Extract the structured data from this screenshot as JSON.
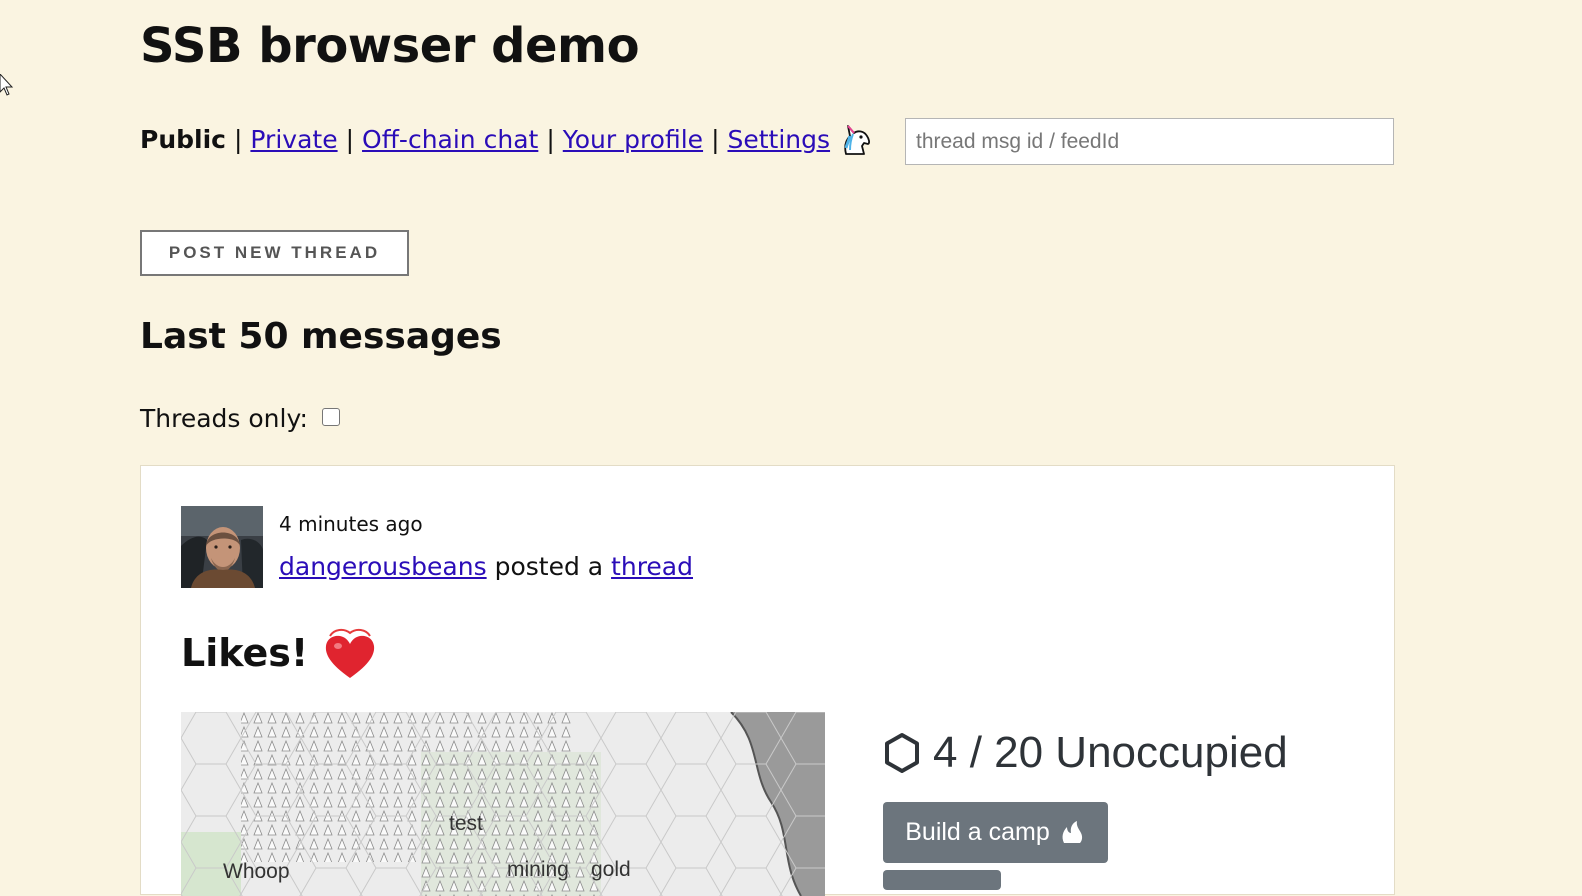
{
  "app": {
    "title": "SSB browser demo"
  },
  "nav": {
    "current": "Public",
    "separator": "|",
    "links": [
      "Private",
      "Off-chain chat",
      "Your profile",
      "Settings"
    ],
    "unicorn_icon": "unicorn-icon"
  },
  "search": {
    "placeholder": "thread msg id / feedId"
  },
  "toolbar": {
    "post_new_thread": "POST NEW THREAD"
  },
  "feed": {
    "heading": "Last 50 messages",
    "threads_only_label": "Threads only:",
    "threads_only_checked": false
  },
  "message": {
    "time": "4 minutes ago",
    "author": "dangerousbeans",
    "action": "posted a",
    "target": "thread",
    "title": "Likes!",
    "title_emoji": "heart-icon"
  },
  "map": {
    "labels": [
      "test",
      "Whoop",
      "mining",
      "gold"
    ]
  },
  "camp": {
    "occupancy": "4 / 20 Unoccupied",
    "build_button": "Build a camp"
  },
  "colors": {
    "background": "#faf4e1",
    "link": "#2a0cb8",
    "button_gray": "#6c757d"
  }
}
